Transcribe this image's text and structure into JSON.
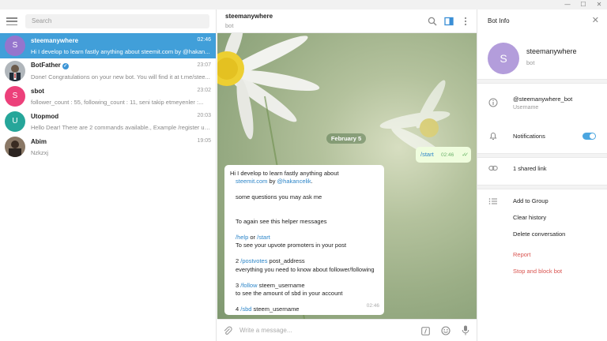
{
  "window": {
    "controls": [
      "—",
      "☐",
      "✕"
    ]
  },
  "search": {
    "placeholder": "Search"
  },
  "chats": [
    {
      "name": "steemanywhere",
      "time": "02:46",
      "preview": "Hi I develop to learn fastly anything about steemit.com by @hakan...",
      "avatar": "S",
      "avatar_color": "#9575cd",
      "active": true
    },
    {
      "name": "BotFather",
      "time": "23:07",
      "preview": "Done! Congratulations on your new bot. You will find it at t.me/stee...",
      "avatar": "",
      "avatar_color": "#5b6b7a",
      "verified": true
    },
    {
      "name": "sbot",
      "time": "23:02",
      "preview": "follower_count : 55,     following_count : 11,     seni takip etmeyenler :...",
      "avatar": "S",
      "avatar_color": "#ec407a"
    },
    {
      "name": "Utopmod",
      "time": "20:03",
      "preview": "Hello Dear! There are 2 commands available., Example /register user...",
      "avatar": "U",
      "avatar_color": "#26a69a"
    },
    {
      "name": "Abim",
      "time": "19:05",
      "preview": "Nzkzxj",
      "avatar": "",
      "avatar_color": "#6d5a48"
    }
  ],
  "conversation": {
    "title": "steemanywhere",
    "subtitle": "bot",
    "date_label": "February 5",
    "outgoing": {
      "text": "/start",
      "time": "02:46"
    },
    "incoming": {
      "time": "02:46",
      "line1": "Hi I develop to learn fastly anything about",
      "line2_link1": "steemit.com",
      "line2_mid": " by ",
      "line2_link2": "@hakancelik",
      "line2_end": ".",
      "line3": "some questions you may ask me",
      "line4": "To again see this helper messages",
      "help_cmd": "/help",
      "or": " or ",
      "start_cmd": "/start",
      "line6": "To see your upvote promoters in your post",
      "item2_num": "2 ",
      "item2_cmd": "/postvotes",
      "item2_arg": " post_address",
      "item2_desc": "everything you need to know about follower/following",
      "item3_num": "3 ",
      "item3_cmd": "/follow",
      "item3_arg": " steem_username",
      "item3_desc": "to see the amount of sbd in your account",
      "item4_num": "4 ",
      "item4_cmd": "/sbd",
      "item4_arg": " steem_username"
    },
    "composer_placeholder": "Write a message..."
  },
  "bot_info": {
    "title": "Bot Info",
    "avatar": "S",
    "name": "steemanywhere",
    "type": "bot",
    "username": "@steemanywhere_bot",
    "username_label": "Username",
    "notifications_label": "Notifications",
    "notifications_on": true,
    "shared": "1 shared link",
    "add_to_group": "Add to Group",
    "clear_history": "Clear history",
    "delete_conversation": "Delete conversation",
    "report": "Report",
    "stop_block": "Stop and block bot"
  },
  "colors": {
    "accent": "#419fd9",
    "danger": "#d9534f",
    "toggle": "#4ba6e0"
  }
}
